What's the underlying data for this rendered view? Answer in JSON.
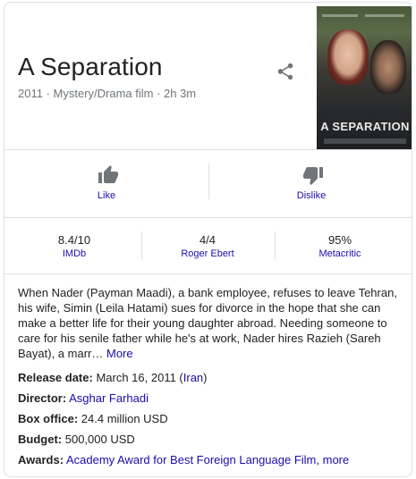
{
  "movie": {
    "title": "A Separation",
    "subtitle": "2011 · Mystery/Drama film · 2h 3m",
    "poster_title": "A SEPARATION"
  },
  "actions": {
    "like_label": "Like",
    "dislike_label": "Dislike",
    "share_icon": "share-icon"
  },
  "ratings": [
    {
      "value": "8.4/10",
      "source": "IMDb"
    },
    {
      "value": "4/4",
      "source": "Roger Ebert"
    },
    {
      "value": "95%",
      "source": "Metacritic"
    }
  ],
  "description": {
    "text": "When Nader (Payman Maadi), a bank employee, refuses to leave Tehran, his wife, Simin (Leila Hatami) sues for divorce in the hope that she can make a better life for their young daughter abroad. Needing someone to care for his senile father while he's at work, Nader hires Razieh (Sareh Bayat), a marr…",
    "more_label": "More"
  },
  "facts": {
    "release_label": "Release date:",
    "release_value": "March 16, 2011 (",
    "release_link": "Iran",
    "release_close": ")",
    "director_label": "Director:",
    "director_link": "Asghar Farhadi",
    "boxoffice_label": "Box office:",
    "boxoffice_value": "24.4 million USD",
    "budget_label": "Budget:",
    "budget_value": "500,000 USD",
    "awards_label": "Awards:",
    "awards_link": "Academy Award for Best Foreign Language Film",
    "awards_sep": ", ",
    "awards_more": "more"
  },
  "colors": {
    "link": "#1a0dab",
    "secondary_text": "#70757a",
    "icon_gray": "#70757a",
    "border": "#dfe1e5"
  }
}
